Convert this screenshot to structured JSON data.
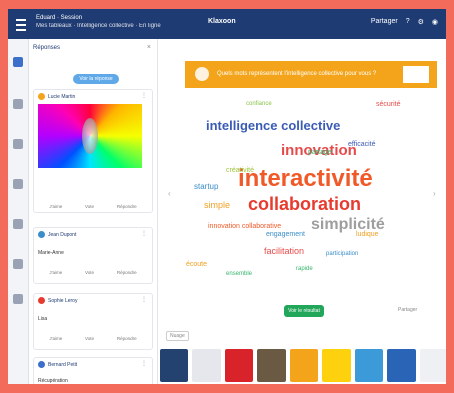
{
  "topbar": {
    "title": "Eduard · Session",
    "subtitle": "Mes tableaux · Intelligence collective · En ligne",
    "logo": "Klaxoon",
    "right_items": [
      "Partager",
      "?",
      "⚙",
      "◉"
    ]
  },
  "sidebar": {
    "header": "Réponses",
    "close": "×",
    "add_button": "Voir la réponse",
    "cards": [
      {
        "author": "Lucie Martin",
        "text": "",
        "actions": [
          "J'aime",
          "Vote",
          "Répondre"
        ]
      },
      {
        "author": "Jean Dupont",
        "text": "Marie-Anne",
        "actions": [
          "J'aime",
          "Vote",
          "Répondre"
        ]
      },
      {
        "author": "Sophie Leroy",
        "text": "Lisa",
        "actions": [
          "J'aime",
          "Vote",
          "Répondre"
        ]
      },
      {
        "author": "Bernard Petit",
        "text": "Récupération",
        "actions": [
          "J'aime",
          "Vote",
          "Répondre"
        ]
      }
    ]
  },
  "main": {
    "question": "Quels mots représentent l'intelligence collective pour vous ?",
    "cta": "Voir le résultat",
    "share": "Partager",
    "tag": "Nuage",
    "words": [
      {
        "t": "interactivité",
        "c": "#f05a28"
      },
      {
        "t": "collaboration",
        "c": "#e83b2f"
      },
      {
        "t": "intelligence collective",
        "c": "#3b5cb5"
      },
      {
        "t": "innovation",
        "c": "#e64b4b"
      },
      {
        "t": "simplicité",
        "c": "#9e9e9e"
      },
      {
        "t": "startup",
        "c": "#3b8ec9"
      },
      {
        "t": "simple",
        "c": "#f0a023"
      },
      {
        "t": "partage",
        "c": "#38b46e"
      },
      {
        "t": "engagement",
        "c": "#3b8ec9"
      },
      {
        "t": "facilitation",
        "c": "#e64b4b"
      },
      {
        "t": "créativité",
        "c": "#9bc43a"
      },
      {
        "t": "efficacité",
        "c": "#3b5cb5"
      },
      {
        "t": "écoute",
        "c": "#f0a023"
      },
      {
        "t": "ensemble",
        "c": "#38b46e"
      },
      {
        "t": "confiance",
        "c": "#8bc34a"
      },
      {
        "t": "innovation collaborative",
        "c": "#f05a28"
      },
      {
        "t": "participation",
        "c": "#3b8ec9"
      },
      {
        "t": "sécurité",
        "c": "#e64b4b"
      },
      {
        "t": "rapide",
        "c": "#38b46e"
      },
      {
        "t": "ludique",
        "c": "#f0a023"
      }
    ]
  }
}
